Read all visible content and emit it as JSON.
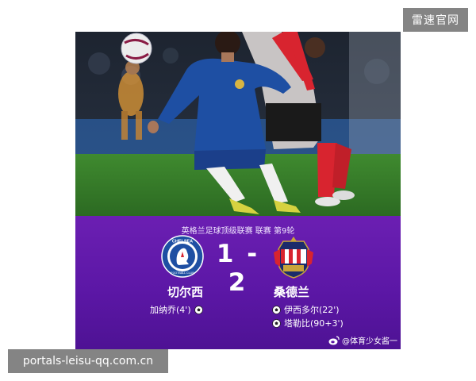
{
  "watermarks": {
    "top": "雷速官网",
    "bottom": "portals-leisu-qq.com.cn"
  },
  "match": {
    "competition": "英格兰足球顶级联赛 联赛 第9轮",
    "score": "1 - 2",
    "home": {
      "name": "切尔西",
      "crest_text": "CHELSEA",
      "crest_subtext": "FOOTBALL CLUB",
      "scorers": [
        "加纳乔(4')"
      ]
    },
    "away": {
      "name": "桑德兰",
      "scorers": [
        "伊西多尔(22')",
        "塔勒比(90+3')"
      ]
    }
  },
  "credit": "@体育少女酱一",
  "colors": {
    "panel": "#5c17a6",
    "chelsea_blue": "#1e4fa3",
    "sunderland_red": "#d8242f"
  }
}
